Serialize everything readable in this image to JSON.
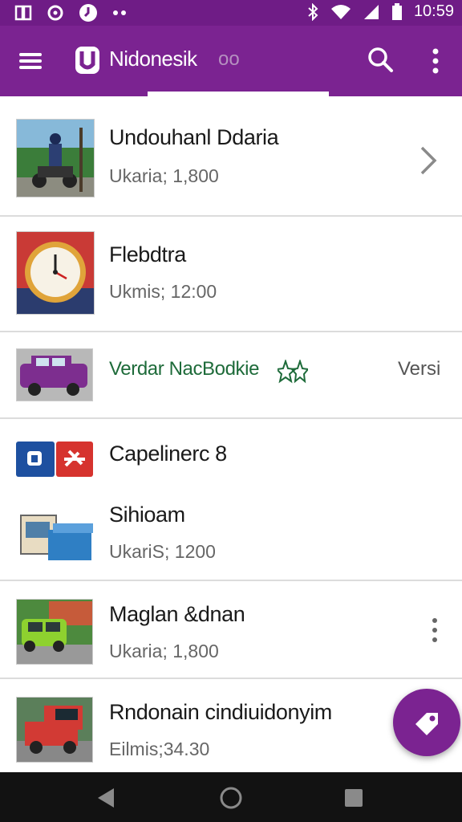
{
  "status_bar": {
    "time": "10:59"
  },
  "app_bar": {
    "title": "Nidonesik",
    "title_faded": "oo"
  },
  "items": [
    {
      "title": "Undouhanl Ddaria",
      "subtitle": "Ukaria; 1,800"
    },
    {
      "title": "Flebdtra",
      "subtitle": "Ukmis; 12:00"
    },
    {
      "title": "Verdar NacBodkie",
      "trailing": "Versi"
    },
    {
      "title": "Capelinerc 8"
    },
    {
      "title": "Sihioam",
      "subtitle": "UkariS; 1200"
    },
    {
      "title": "Maglan &dnan",
      "subtitle": "Ukaria; 1,800"
    },
    {
      "title": "Rndonain cindiuidonyim",
      "subtitle": "Eilmis;34.30"
    }
  ],
  "colors": {
    "primary": "#7b2391",
    "status_bar": "#6f1c86",
    "accent_text": "#1e6b3a"
  }
}
